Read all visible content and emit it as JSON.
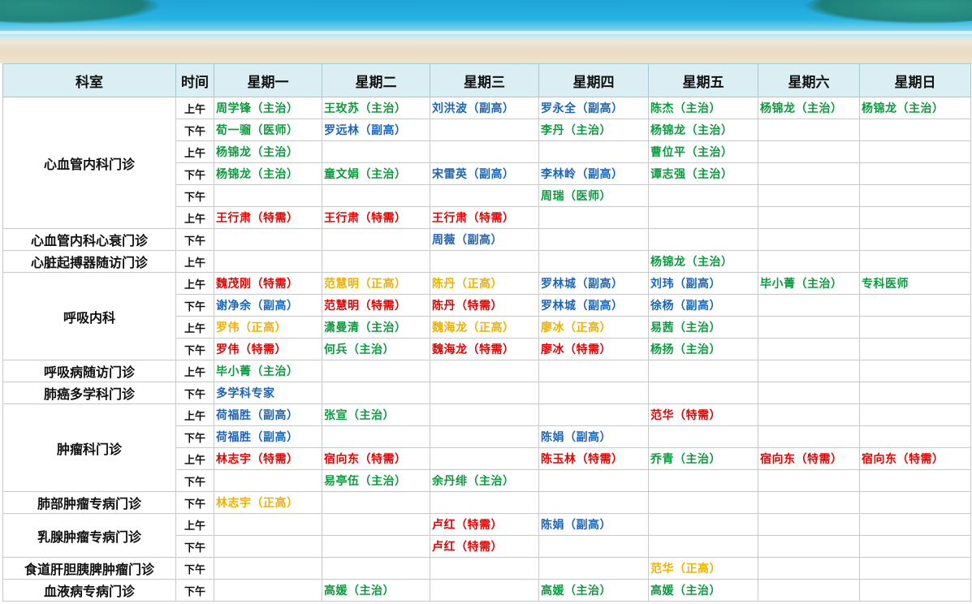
{
  "colors": {
    "green": "#0d9a3e",
    "blue": "#1b64b7",
    "red": "#e60000",
    "orange": "#f0b000",
    "header_bg": "#dbeef3"
  },
  "headers": [
    "科室",
    "时间",
    "星期一",
    "星期二",
    "星期三",
    "星期四",
    "星期五",
    "星期六",
    "星期日"
  ],
  "rows": [
    {
      "dept": "心血管内科门诊",
      "span": 6,
      "time": "上午",
      "cells": [
        [
          "周学锋（主治）",
          "green"
        ],
        [
          "王玫苏（主治）",
          "green"
        ],
        [
          "刘洪波（副高）",
          "blue"
        ],
        [
          "罗永全（副高）",
          "blue"
        ],
        [
          "陈杰（主治）",
          "green"
        ],
        [
          "杨锦龙（主治）",
          "green"
        ],
        [
          "杨锦龙（主治）",
          "green"
        ]
      ]
    },
    {
      "time": "下午",
      "cells": [
        [
          "荀一骝（医师）",
          "green"
        ],
        [
          "罗远林（副高）",
          "blue"
        ],
        [
          "",
          ""
        ],
        [
          "李丹（主治）",
          "green"
        ],
        [
          "杨锦龙（主治）",
          "green"
        ],
        [
          "",
          ""
        ],
        [
          "",
          ""
        ]
      ]
    },
    {
      "time": "上午",
      "cells": [
        [
          "杨锦龙（主治）",
          "green"
        ],
        [
          "",
          ""
        ],
        [
          "",
          ""
        ],
        [
          "",
          ""
        ],
        [
          "曹位平（主治）",
          "green"
        ],
        [
          "",
          ""
        ],
        [
          "",
          ""
        ]
      ]
    },
    {
      "time": "下午",
      "cells": [
        [
          "杨锦龙（主治）",
          "green"
        ],
        [
          "童文娟（主治）",
          "green"
        ],
        [
          "宋雷英（副高）",
          "blue"
        ],
        [
          "李林岭（副高）",
          "blue"
        ],
        [
          "谭志强（主治）",
          "green"
        ],
        [
          "",
          ""
        ],
        [
          "",
          ""
        ]
      ]
    },
    {
      "time": "下午",
      "cells": [
        [
          "",
          ""
        ],
        [
          "",
          ""
        ],
        [
          "",
          ""
        ],
        [
          "周瑞（医师）",
          "green"
        ],
        [
          "",
          ""
        ],
        [
          "",
          ""
        ],
        [
          "",
          ""
        ]
      ]
    },
    {
      "time": "上午",
      "cells": [
        [
          "王行肃（特需）",
          "red"
        ],
        [
          "王行肃（特需）",
          "red"
        ],
        [
          "王行肃（特需）",
          "red"
        ],
        [
          "",
          ""
        ],
        [
          "",
          ""
        ],
        [
          "",
          ""
        ],
        [
          "",
          ""
        ]
      ]
    },
    {
      "dept": "心血管内科心衰门诊",
      "span": 1,
      "time": "下午",
      "cells": [
        [
          "",
          ""
        ],
        [
          "",
          ""
        ],
        [
          "周薇（副高）",
          "blue"
        ],
        [
          "",
          ""
        ],
        [
          "",
          ""
        ],
        [
          "",
          ""
        ],
        [
          "",
          ""
        ]
      ]
    },
    {
      "dept": "心脏起搏器随访门诊",
      "span": 1,
      "time": "上午",
      "cells": [
        [
          "",
          ""
        ],
        [
          "",
          ""
        ],
        [
          "",
          ""
        ],
        [
          "",
          ""
        ],
        [
          "杨锦龙（主治）",
          "green"
        ],
        [
          "",
          ""
        ],
        [
          "",
          ""
        ]
      ]
    },
    {
      "dept": "呼吸内科",
      "span": 4,
      "time": "上午",
      "cells": [
        [
          "魏茂刚（特需）",
          "red"
        ],
        [
          "范慧明（正高）",
          "orange"
        ],
        [
          "陈丹（正高）",
          "orange"
        ],
        [
          "罗林城（副高）",
          "blue"
        ],
        [
          "刘玮（副高）",
          "blue"
        ],
        [
          "毕小菁（主治）",
          "green"
        ],
        [
          "专科医师",
          "green"
        ]
      ]
    },
    {
      "time": "下午",
      "cells": [
        [
          "谢净余（副高）",
          "blue"
        ],
        [
          "范慧明（特需）",
          "red"
        ],
        [
          "陈丹（特需）",
          "red"
        ],
        [
          "罗林城（副高）",
          "blue"
        ],
        [
          "徐杨（副高）",
          "blue"
        ],
        [
          "",
          ""
        ],
        [
          "",
          ""
        ]
      ]
    },
    {
      "time": "上午",
      "cells": [
        [
          "罗伟（正高）",
          "orange"
        ],
        [
          "潇曼清（主治）",
          "green"
        ],
        [
          "魏海龙（正高）",
          "orange"
        ],
        [
          "廖冰（正高）",
          "orange"
        ],
        [
          "易茜（主治）",
          "green"
        ],
        [
          "",
          ""
        ],
        [
          "",
          ""
        ]
      ]
    },
    {
      "time": "下午",
      "cells": [
        [
          "罗伟（特需）",
          "red"
        ],
        [
          "何兵（主治）",
          "green"
        ],
        [
          "魏海龙（特需）",
          "red"
        ],
        [
          "廖冰（特需）",
          "red"
        ],
        [
          "杨扬（主治）",
          "green"
        ],
        [
          "",
          ""
        ],
        [
          "",
          ""
        ]
      ]
    },
    {
      "dept": "呼吸病随访门诊",
      "span": 1,
      "time": "上午",
      "cells": [
        [
          "毕小菁（主治）",
          "green"
        ],
        [
          "",
          ""
        ],
        [
          "",
          ""
        ],
        [
          "",
          ""
        ],
        [
          "",
          ""
        ],
        [
          "",
          ""
        ],
        [
          "",
          ""
        ]
      ]
    },
    {
      "dept": "肺癌多学科门诊",
      "span": 1,
      "time": "下午",
      "cells": [
        [
          "多学科专家",
          "blue"
        ],
        [
          "",
          ""
        ],
        [
          "",
          ""
        ],
        [
          "",
          ""
        ],
        [
          "",
          ""
        ],
        [
          "",
          ""
        ],
        [
          "",
          ""
        ]
      ]
    },
    {
      "dept": "肿瘤科门诊",
      "span": 4,
      "time": "上午",
      "cells": [
        [
          "荷福胜（副高）",
          "blue"
        ],
        [
          "张宣（主治）",
          "green"
        ],
        [
          "",
          ""
        ],
        [
          "",
          ""
        ],
        [
          "范华（特需）",
          "red"
        ],
        [
          "",
          ""
        ],
        [
          "",
          ""
        ]
      ]
    },
    {
      "time": "下午",
      "cells": [
        [
          "荷福胜（副高）",
          "blue"
        ],
        [
          "",
          ""
        ],
        [
          "",
          ""
        ],
        [
          "陈娟（副高）",
          "blue"
        ],
        [
          "",
          ""
        ],
        [
          "",
          ""
        ],
        [
          "",
          ""
        ]
      ]
    },
    {
      "time": "上午",
      "cells": [
        [
          "林志宇（特需）",
          "red"
        ],
        [
          "宿向东（特需）",
          "red"
        ],
        [
          "",
          ""
        ],
        [
          "陈玉林（特需）",
          "red"
        ],
        [
          "乔青（主治）",
          "green"
        ],
        [
          "宿向东（特需）",
          "red"
        ],
        [
          "宿向东（特需）",
          "red"
        ]
      ]
    },
    {
      "time": "下午",
      "cells": [
        [
          "",
          ""
        ],
        [
          "易亭伍（主治）",
          "green"
        ],
        [
          "余丹绯（主治）",
          "green"
        ],
        [
          "",
          ""
        ],
        [
          "",
          ""
        ],
        [
          "",
          ""
        ],
        [
          "",
          ""
        ]
      ]
    },
    {
      "dept": "肺部肿瘤专病门诊",
      "span": 1,
      "time": "下午",
      "cells": [
        [
          "林志宇（正高）",
          "orange"
        ],
        [
          "",
          ""
        ],
        [
          "",
          ""
        ],
        [
          "",
          ""
        ],
        [
          "",
          ""
        ],
        [
          "",
          ""
        ],
        [
          "",
          ""
        ]
      ]
    },
    {
      "dept": "乳腺肿瘤专病门诊",
      "span": 2,
      "time": "上午",
      "cells": [
        [
          "",
          ""
        ],
        [
          "",
          ""
        ],
        [
          "卢红（特需）",
          "red"
        ],
        [
          "陈娟（副高）",
          "blue"
        ],
        [
          "",
          ""
        ],
        [
          "",
          ""
        ],
        [
          "",
          ""
        ]
      ]
    },
    {
      "time": "下午",
      "cells": [
        [
          "",
          ""
        ],
        [
          "",
          ""
        ],
        [
          "卢红（特需）",
          "red"
        ],
        [
          "",
          ""
        ],
        [
          "",
          ""
        ],
        [
          "",
          ""
        ],
        [
          "",
          ""
        ]
      ]
    },
    {
      "dept": "食道肝胆胰脾肿瘤门诊",
      "span": 1,
      "time": "下午",
      "cells": [
        [
          "",
          ""
        ],
        [
          "",
          ""
        ],
        [
          "",
          ""
        ],
        [
          "",
          ""
        ],
        [
          "范华（正高）",
          "orange"
        ],
        [
          "",
          ""
        ],
        [
          "",
          ""
        ]
      ]
    },
    {
      "dept": "血液病专病门诊",
      "span": 1,
      "time": "下午",
      "cells": [
        [
          "",
          ""
        ],
        [
          "高媛（主治）",
          "green"
        ],
        [
          "",
          ""
        ],
        [
          "高媛（主治）",
          "green"
        ],
        [
          "高媛（主治）",
          "green"
        ],
        [
          "",
          ""
        ],
        [
          "",
          ""
        ]
      ]
    }
  ]
}
